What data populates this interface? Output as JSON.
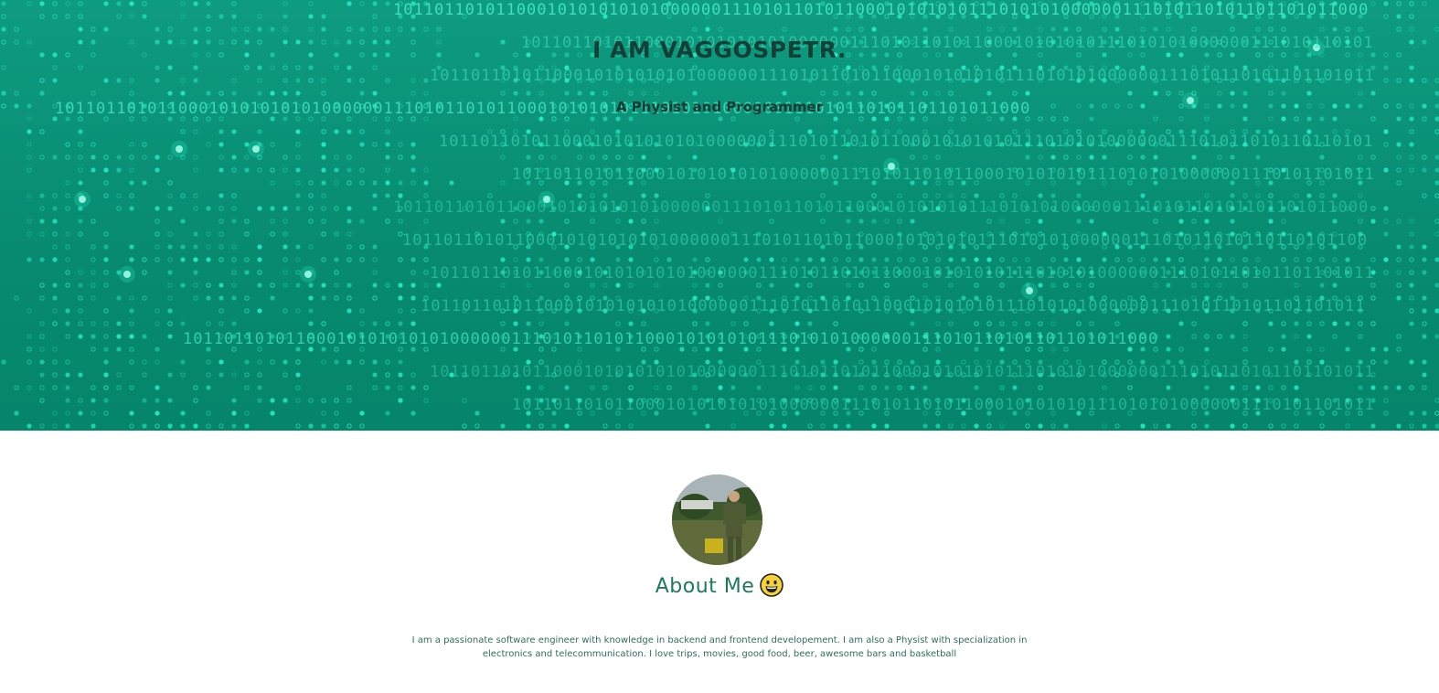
{
  "hero": {
    "title": "I AM VAGGOSPETR.",
    "subtitle": "A Physist and Programmer",
    "background_colors": {
      "start": "#0e9c80",
      "end": "#05866b",
      "dot": "#29f0c8",
      "binary": "#3ee0bc"
    },
    "binary_pattern": "10110110101100010101010101000000111010110101100010101010111010101000000111010110"
  },
  "about": {
    "avatar_icon": "profile-photo",
    "heading": "About Me",
    "heading_emoji": "grinning-face-icon",
    "text": "I am a passionate software engineer with knowledge in backend and frontend developement. I am also a Physist with specialization in electronics and telecommunication. I love trips, movies, good food, beer, awesome bars and basketball"
  }
}
